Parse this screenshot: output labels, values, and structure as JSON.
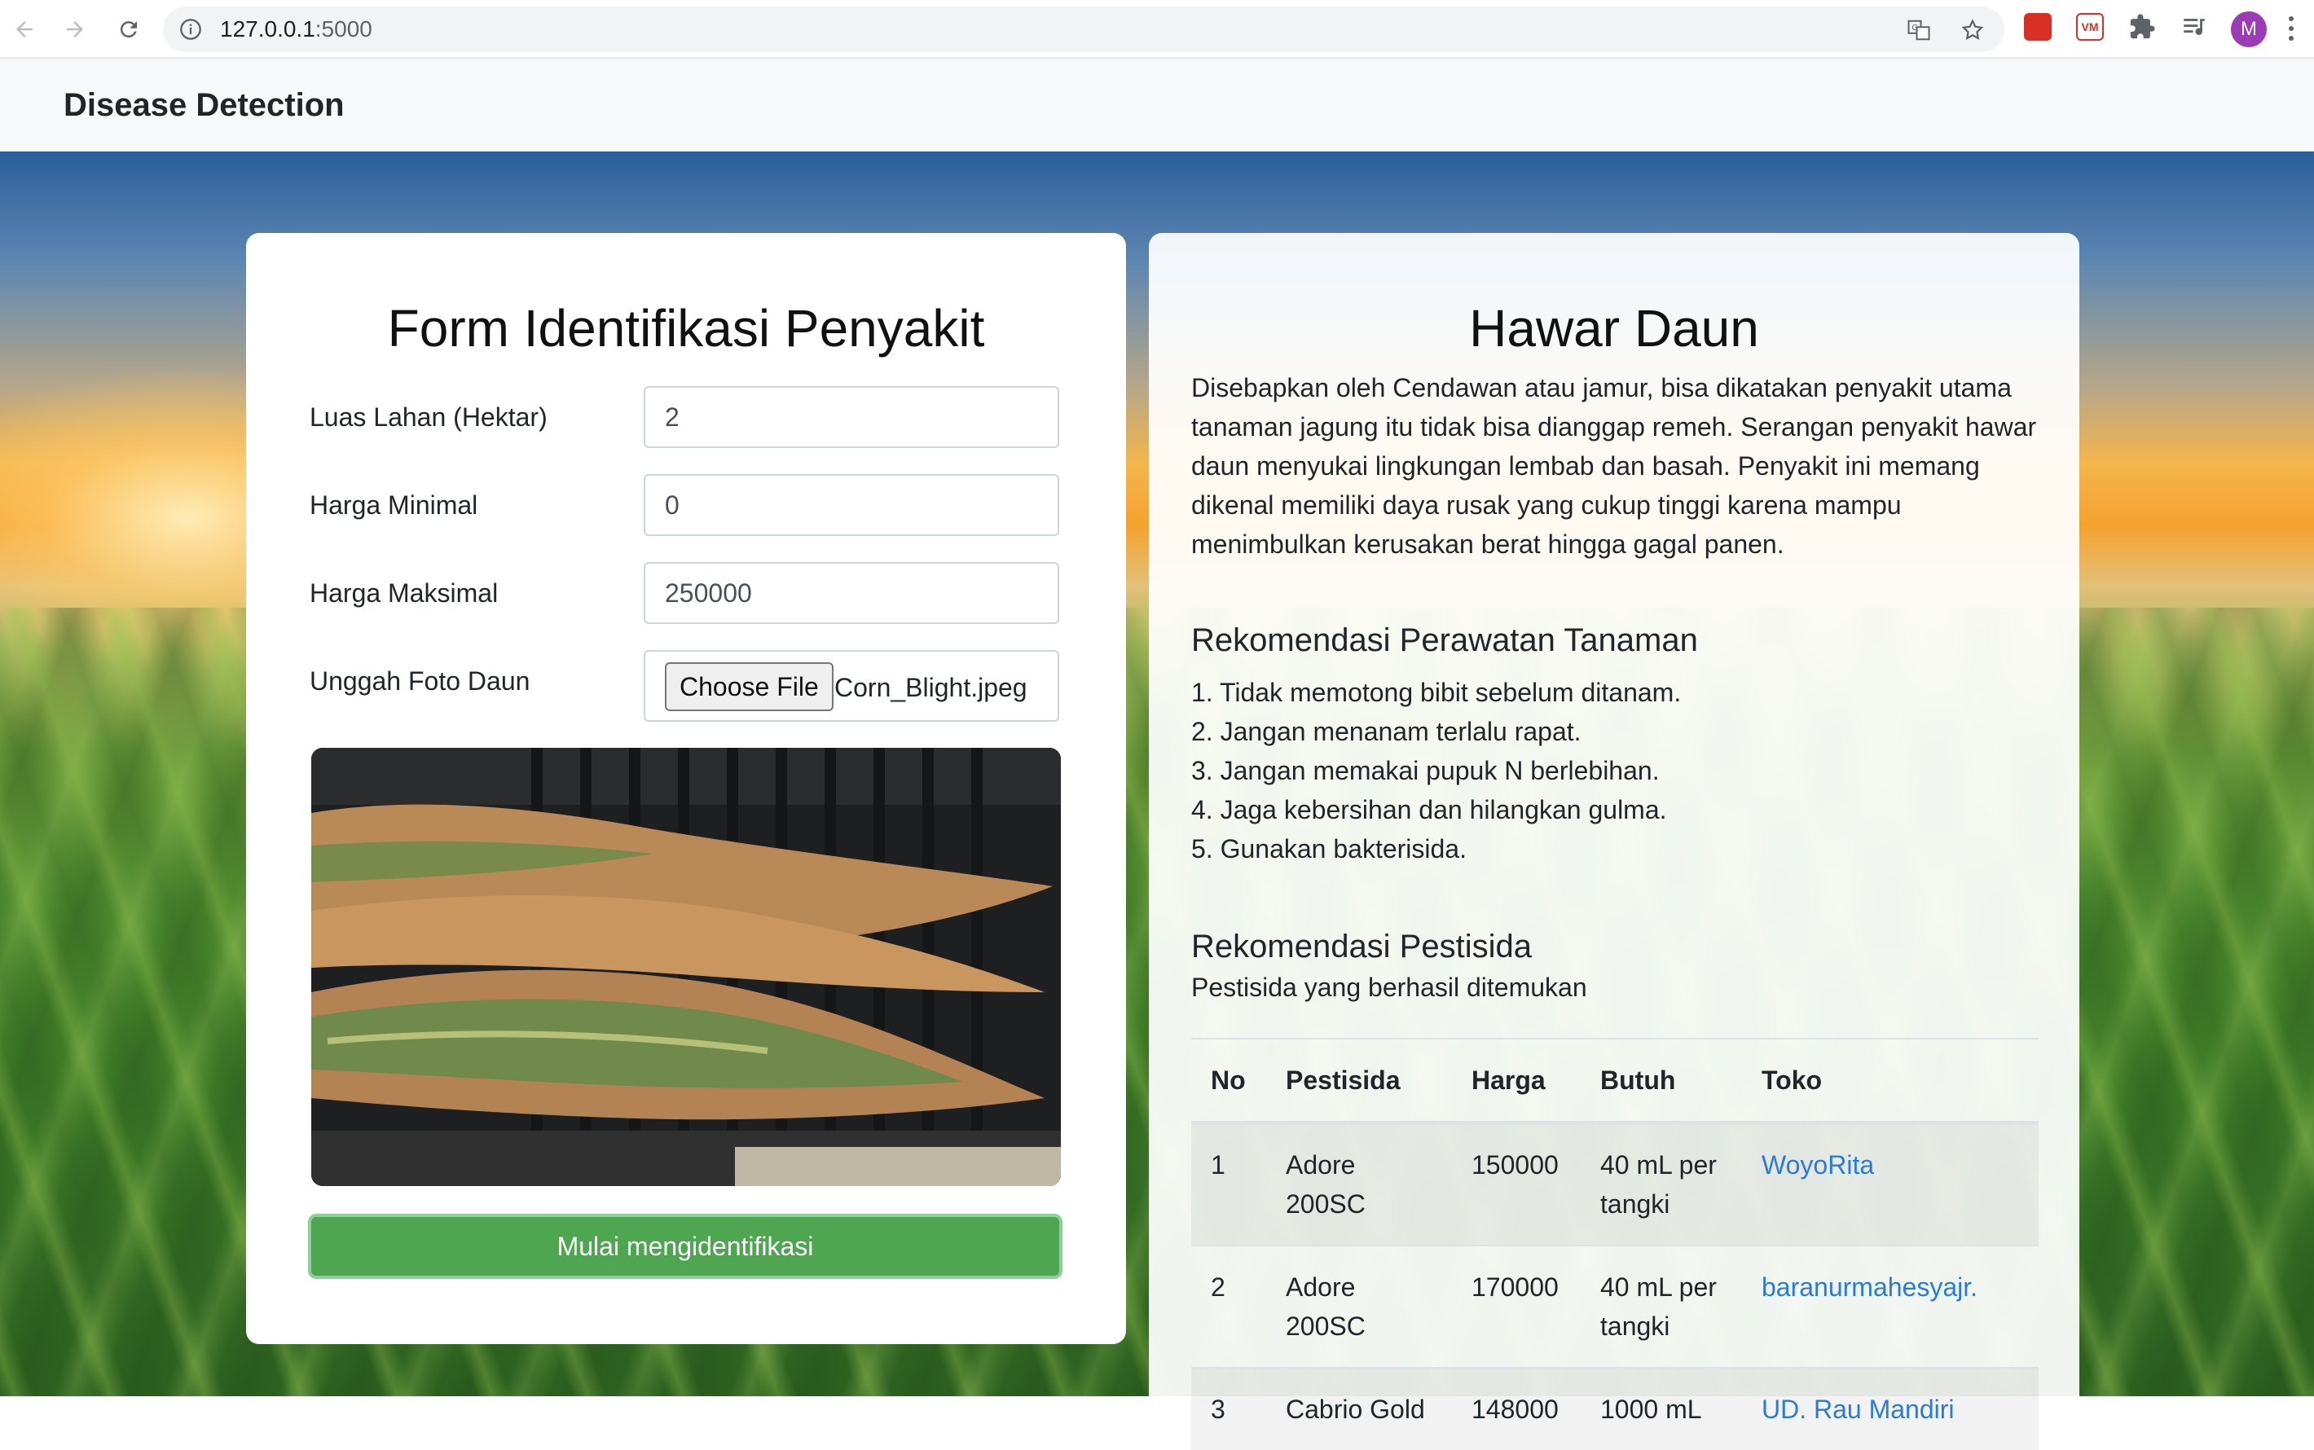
{
  "browser": {
    "url_host": "127.0.0.1",
    "url_port": ":5000",
    "avatar_letter": "M"
  },
  "navbar": {
    "brand": "Disease Detection"
  },
  "form": {
    "title": "Form Identifikasi Penyakit",
    "fields": [
      {
        "label": "Luas Lahan (Hektar)",
        "value": "2"
      },
      {
        "label": "Harga Minimal",
        "value": "0"
      },
      {
        "label": "Harga Maksimal",
        "value": "250000"
      }
    ],
    "upload": {
      "label": "Unggah Foto Daun",
      "button": "Choose File",
      "file_name": "Corn_Blight.jpeg"
    },
    "submit_label": "Mulai mengidentifikasi"
  },
  "result": {
    "title": "Hawar Daun",
    "description": "Disebapkan oleh Cendawan atau jamur, bisa dikatakan penyakit utama tanaman jagung itu tidak bisa dianggap remeh. Serangan penyakit hawar daun menyukai lingkungan lembab dan basah. Penyakit ini memang dikenal memiliki daya rusak yang cukup tinggi karena mampu menimbulkan kerusakan berat hingga gagal panen.",
    "care_heading": "Rekomendasi Perawatan Tanaman",
    "care_items": [
      "1. Tidak memotong bibit sebelum ditanam.",
      "2. Jangan menanam terlalu rapat.",
      "3. Jangan memakai pupuk N berlebihan.",
      "4. Jaga kebersihan dan hilangkan gulma.",
      "5. Gunakan bakterisida."
    ],
    "pest_heading": "Rekomendasi Pestisida",
    "pest_sub": "Pestisida yang berhasil ditemukan",
    "table": {
      "headers": [
        "No",
        "Pestisida",
        "Harga",
        "Butuh",
        "Toko"
      ],
      "rows": [
        {
          "no": "1",
          "pestisida": "Adore 200SC",
          "harga": "150000",
          "butuh": "40 mL per tangki",
          "toko": "WoyoRita"
        },
        {
          "no": "2",
          "pestisida": "Adore 200SC",
          "harga": "170000",
          "butuh": "40 mL per tangki",
          "toko": "baranurmahesyajr."
        },
        {
          "no": "3",
          "pestisida": "Cabrio Gold",
          "harga": "148000",
          "butuh": "1000 mL",
          "toko": "UD. Rau Mandiri"
        }
      ]
    }
  }
}
